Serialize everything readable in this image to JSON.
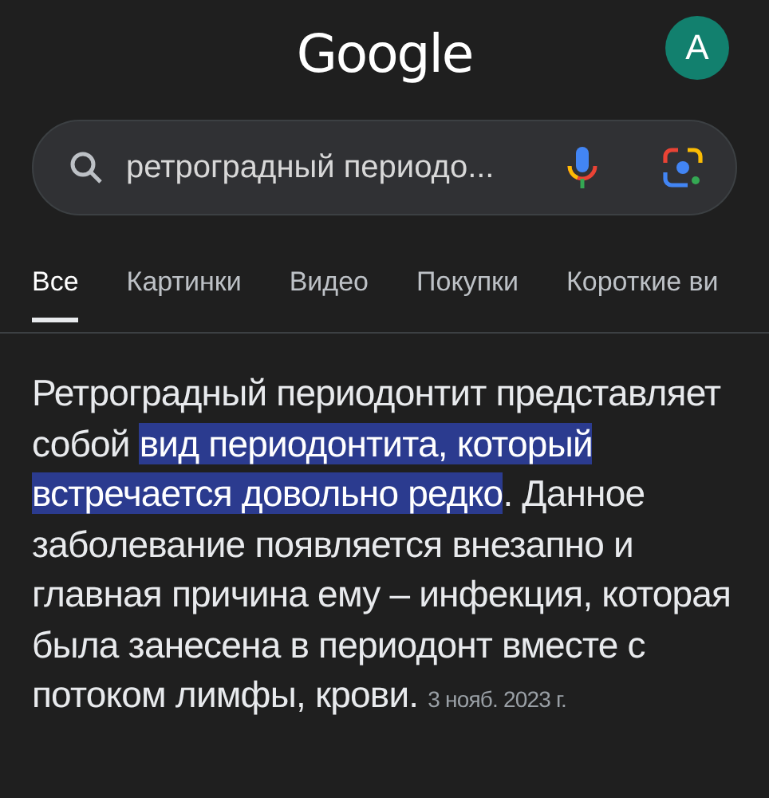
{
  "header": {
    "logo": "Google",
    "avatar": "A"
  },
  "search": {
    "value": "ретроградный периодо..."
  },
  "tabs": [
    {
      "label": "Все",
      "selected": true
    },
    {
      "label": "Картинки",
      "selected": false
    },
    {
      "label": "Видео",
      "selected": false
    },
    {
      "label": "Покупки",
      "selected": false
    },
    {
      "label": "Короткие ви",
      "selected": false
    }
  ],
  "snippet": {
    "text": "Ретроградный периодонтит представляет собой **вид периодонтита, который встречается довольно редко**. Данное заболевание появляется внезапно и главная причина ему – инфекция, которая была занесена в периодонт вместе с потоком лимфы, крови.",
    "date": "3 нояб. 2023 г."
  }
}
